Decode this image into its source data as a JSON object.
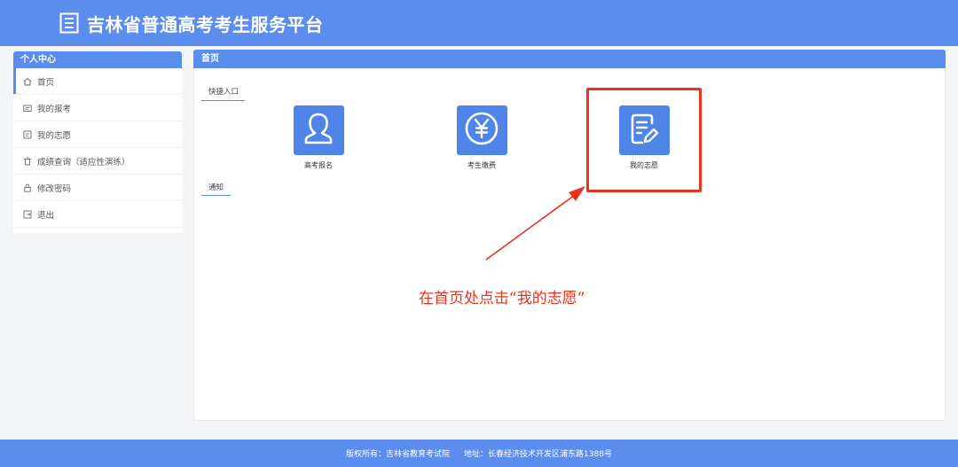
{
  "header": {
    "title": "吉林省普通高考考生服务平台",
    "logo_icon": "document-list-icon"
  },
  "sidebar": {
    "heading": "个人中心",
    "items": [
      {
        "label": "首页",
        "icon": "home-icon",
        "active": true
      },
      {
        "label": "我的报考",
        "icon": "id-card-icon"
      },
      {
        "label": "我的志愿",
        "icon": "form-icon"
      },
      {
        "label": "成绩查询（适应性演练）",
        "icon": "trash-icon"
      },
      {
        "label": "修改密码",
        "icon": "lock-icon"
      },
      {
        "label": "退出",
        "icon": "logout-icon"
      }
    ]
  },
  "main": {
    "heading": "首页",
    "quick_entry_title": "快捷入口",
    "notice_title": "通知",
    "tiles": [
      {
        "label": "高考报名",
        "icon": "user-icon"
      },
      {
        "label": "考生缴费",
        "icon": "yen-icon"
      },
      {
        "label": "我的志愿",
        "icon": "edit-document-icon"
      }
    ]
  },
  "annotation": {
    "text": "在首页处点击“我的志愿”",
    "color": "#e8321f"
  },
  "footer": {
    "copyright": "版权所有：吉林省教育考试院",
    "address": "地址：长春经济技术开发区浦东路1388号"
  },
  "colors": {
    "primary": "#5b8def",
    "tile": "#4f84e8",
    "annotation": "#e8321f"
  }
}
